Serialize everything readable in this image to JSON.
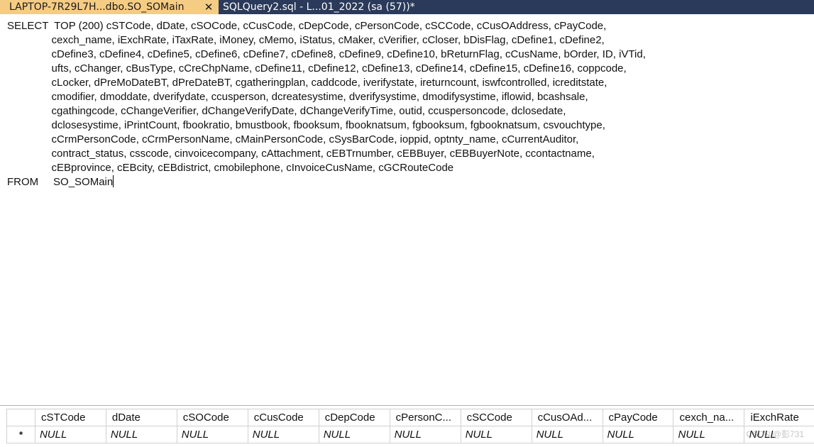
{
  "tabs": [
    {
      "label": "LAPTOP-7R29L7H...dbo.SO_SOMain",
      "active": true,
      "close_glyph": "✕"
    },
    {
      "label": "SQLQuery2.sql - L...01_2022 (sa (57))*",
      "active": false
    }
  ],
  "editor": {
    "lines": [
      "SELECT  TOP (200) cSTCode, dDate, cSOCode, cCusCode, cDepCode, cPersonCode, cSCCode, cCusOAddress, cPayCode,",
      "               cexch_name, iExchRate, iTaxRate, iMoney, cMemo, iStatus, cMaker, cVerifier, cCloser, bDisFlag, cDefine1, cDefine2,",
      "               cDefine3, cDefine4, cDefine5, cDefine6, cDefine7, cDefine8, cDefine9, cDefine10, bReturnFlag, cCusName, bOrder, ID, iVTid,",
      "               ufts, cChanger, cBusType, cCreChpName, cDefine11, cDefine12, cDefine13, cDefine14, cDefine15, cDefine16, coppcode,",
      "               cLocker, dPreMoDateBT, dPreDateBT, cgatheringplan, caddcode, iverifystate, ireturncount, iswfcontrolled, icreditstate,",
      "               cmodifier, dmoddate, dverifydate, ccusperson, dcreatesystime, dverifysystime, dmodifysystime, iflowid, bcashsale,",
      "               cgathingcode, cChangeVerifier, dChangeVerifyDate, dChangeVerifyTime, outid, ccuspersoncode, dclosedate,",
      "               dclosesystime, iPrintCount, fbookratio, bmustbook, fbooksum, fbooknatsum, fgbooksum, fgbooknatsum, csvouchtype,",
      "               cCrmPersonCode, cCrmPersonName, cMainPersonCode, cSysBarCode, ioppid, optnty_name, cCurrentAuditor,",
      "               contract_status, csscode, cinvoicecompany, cAttachment, cEBTrnumber, cEBBuyer, cEBBuyerNote, ccontactname,",
      "               cEBprovince, cEBcity, cEBdistrict, cmobilephone, cInvoiceCusName, cGCRouteCode"
    ],
    "from_keyword": "FROM",
    "from_table": "SO_SOMain"
  },
  "grid": {
    "columns": [
      "cSTCode",
      "dDate",
      "cSOCode",
      "cCusCode",
      "cDepCode",
      "cPersonC...",
      "cSCCode",
      "cCusOAd...",
      "cPayCode",
      "cexch_na...",
      "iExchRate"
    ],
    "new_row_marker": "*",
    "row": [
      "NULL",
      "NULL",
      "NULL",
      "NULL",
      "NULL",
      "NULL",
      "NULL",
      "NULL",
      "NULL",
      "NULL",
      "NULL"
    ]
  },
  "watermark": "CSDN @彭731",
  "colors": {
    "tab_active_bg": "#f5cc84",
    "tabstrip_bg": "#2b3a5a",
    "tab_inactive_text": "#ffffff"
  }
}
